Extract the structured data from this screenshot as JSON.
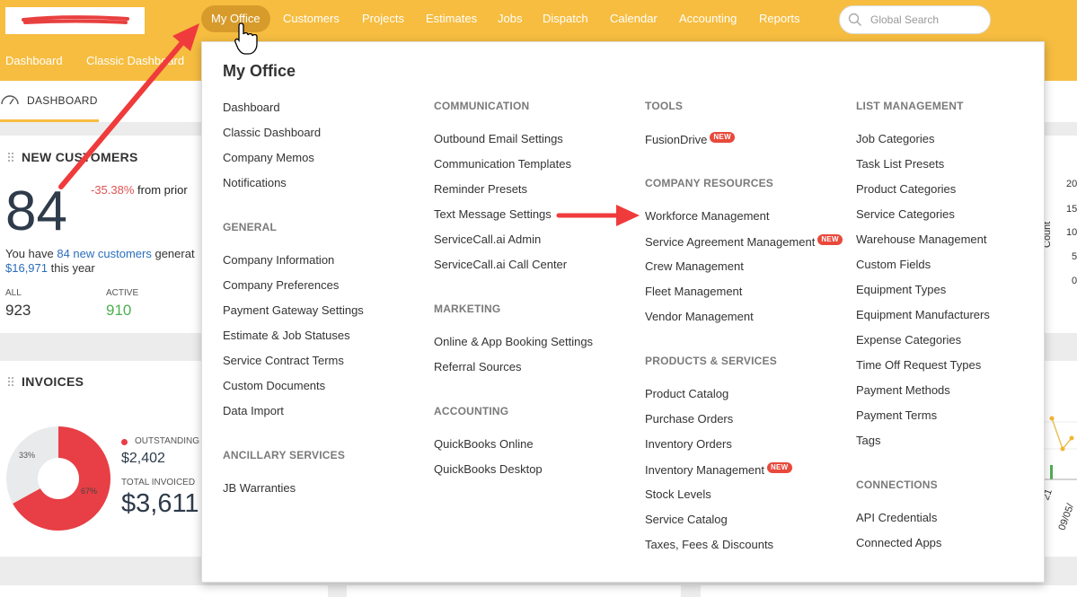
{
  "nav": {
    "items": [
      "My Office",
      "Customers",
      "Projects",
      "Estimates",
      "Jobs",
      "Dispatch",
      "Calendar",
      "Accounting",
      "Reports"
    ],
    "search_placeholder": "Global Search"
  },
  "subnav": {
    "items": [
      "Dashboard",
      "Classic Dashboard"
    ]
  },
  "tab": {
    "label": "DASHBOARD"
  },
  "new_customers": {
    "title": "NEW CUSTOMERS",
    "count": "84",
    "change": "-35.38%",
    "change_suffix": " from prior",
    "line1_prefix": "You have ",
    "line1_link": "84 new customers",
    "line1_suffix": " generat",
    "line2_value": "$16,971",
    "line2_suffix": " this year",
    "all_label": "ALL",
    "all_value": "923",
    "active_label": "ACTIVE",
    "active_value": "910"
  },
  "invoices": {
    "title": "INVOICES",
    "pie_outstanding_pct": "67%",
    "pie_paid_pct": "33%",
    "outstanding_fraction": 0.67,
    "outstanding_label": "OUTSTANDING",
    "outstanding_value": "$2,402",
    "total_label": "TOTAL INVOICED",
    "total_value": "$3,611"
  },
  "right_chart": {
    "axis_ticks": [
      "20",
      "15",
      "10",
      "5",
      "0"
    ],
    "count_label": "Count",
    "date_label_1": "21",
    "date_label_2": "09/05/"
  },
  "menu": {
    "title": "My Office",
    "col1": {
      "items_a": [
        "Dashboard",
        "Classic Dashboard",
        "Company Memos",
        "Notifications"
      ],
      "general_head": "GENERAL",
      "general_items": [
        "Company Information",
        "Company Preferences",
        "Payment Gateway Settings",
        "Estimate & Job Statuses",
        "Service Contract Terms",
        "Custom Documents",
        "Data Import"
      ],
      "ancillary_head": "ANCILLARY SERVICES",
      "ancillary_items": [
        "JB Warranties"
      ]
    },
    "col2": {
      "communication_head": "COMMUNICATION",
      "communication_items": [
        "Outbound Email Settings",
        "Communication Templates",
        "Reminder Presets",
        "Text Message Settings",
        "ServiceCall.ai Admin",
        "ServiceCall.ai Call Center"
      ],
      "marketing_head": "MARKETING",
      "marketing_items": [
        "Online & App Booking Settings",
        "Referral Sources"
      ],
      "accounting_head": "ACCOUNTING",
      "accounting_items": [
        "QuickBooks Online",
        "QuickBooks Desktop"
      ]
    },
    "col3": {
      "tools_head": "TOOLS",
      "tools_items": [
        "FusionDrive"
      ],
      "resources_head": "COMPANY RESOURCES",
      "resources_items": [
        "Workforce Management",
        "Service Agreement Management",
        "Crew Management",
        "Fleet Management",
        "Vendor Management"
      ],
      "products_head": "PRODUCTS & SERVICES",
      "products_items": [
        "Product Catalog",
        "Purchase Orders",
        "Inventory Orders",
        "Inventory Management",
        "Stock Levels",
        "Service Catalog",
        "Taxes, Fees & Discounts"
      ]
    },
    "col4": {
      "list_head": "LIST MANAGEMENT",
      "list_items": [
        "Job Categories",
        "Task List Presets",
        "Product Categories",
        "Service Categories",
        "Warehouse Management",
        "Custom Fields",
        "Equipment Types",
        "Equipment Manufacturers",
        "Expense Categories",
        "Time Off Request Types",
        "Payment Methods",
        "Payment Terms",
        "Tags"
      ],
      "connections_head": "CONNECTIONS",
      "connections_items": [
        "API Credentials",
        "Connected Apps"
      ]
    },
    "new_badge": "NEW"
  },
  "colors": {
    "brand": "#f6bd40",
    "nav_active": "#d79b2b",
    "link": "#2a6ebb",
    "negative": "#e05252",
    "positive": "#4caf50",
    "outstanding": "#e83e45",
    "annotation_arrow": "#ef3b3b"
  }
}
